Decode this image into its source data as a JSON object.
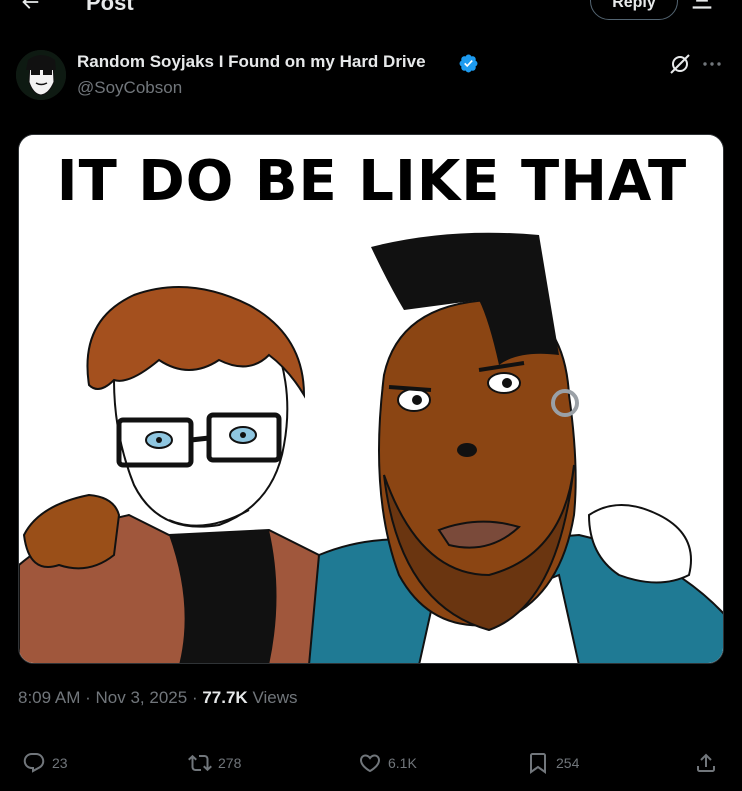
{
  "header": {
    "title": "Post",
    "reply_label": "Reply",
    "back_icon": "arrow-left-icon",
    "settings_icon": "reply-settings-icon"
  },
  "post": {
    "author": {
      "display_name": "Random Soyjaks I Found on my Hard Drive",
      "handle": "@SoyCobson",
      "verified": true,
      "verified_color": "#1d9bf0"
    },
    "media": {
      "caption": "IT DO BE LIKE THAT"
    },
    "time": "8:09 AM",
    "date": "Nov 3, 2025",
    "views_count": "77.7K",
    "views_label": "Views",
    "separator": "·"
  },
  "actions": {
    "replies": "23",
    "reposts": "278",
    "likes": "6.1K",
    "bookmarks": "254"
  },
  "colors": {
    "background": "#000000",
    "text_primary": "#e7e9ea",
    "text_secondary": "#71767b",
    "border": "#2f3336",
    "accent": "#1d9bf0"
  }
}
